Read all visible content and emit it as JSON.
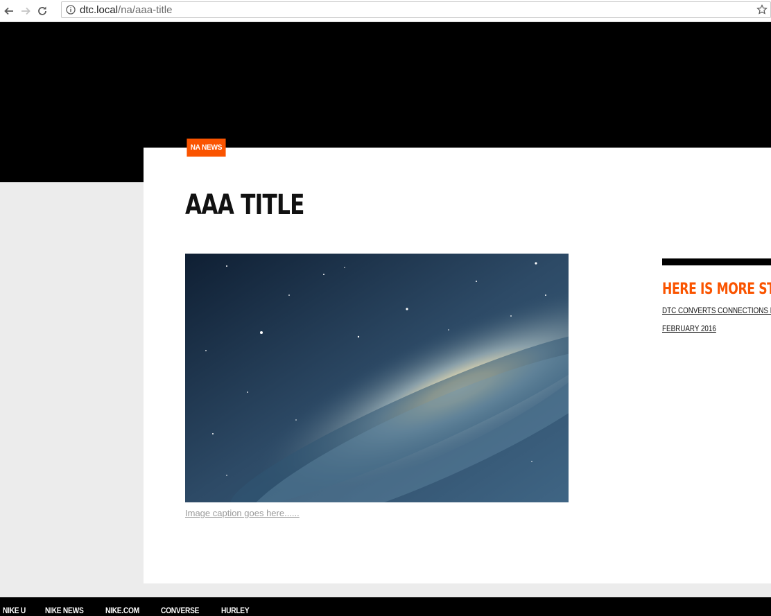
{
  "browser": {
    "url_host": "dtc.local",
    "url_path": "/na/aaa-title"
  },
  "article": {
    "category_badge": "NA NEWS",
    "title": "AAA TITLE",
    "image_alt": "galaxy image",
    "caption": "Image caption goes here......"
  },
  "sidebar": {
    "heading": "HERE IS MORE STUF",
    "link_text": "DTC CONVERTS CONNECTIONS INTO",
    "date": "FEBRUARY 2016"
  },
  "footer": {
    "items": [
      "NIKE U",
      "NIKE NEWS",
      "NIKE.COM",
      "CONVERSE",
      "HURLEY"
    ]
  },
  "colors": {
    "accent": "#fa5400",
    "header_bg": "#000000",
    "page_bg": "#ececec"
  },
  "icons": [
    "back-arrow-icon",
    "forward-arrow-icon",
    "reload-icon",
    "info-icon",
    "bookmark-star-icon"
  ]
}
